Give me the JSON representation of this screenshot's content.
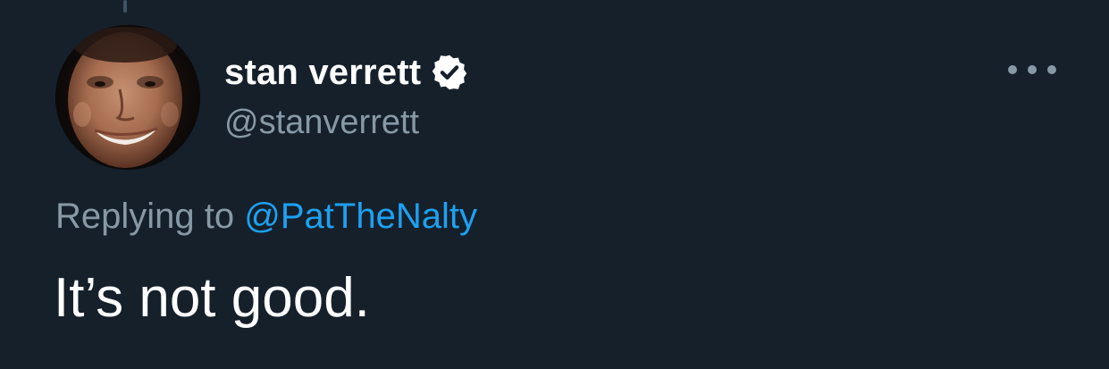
{
  "tweet": {
    "author": {
      "display_name": "stan verrett",
      "handle": "@stanverrett",
      "verified": true,
      "avatar_icon": "user-avatar-photo"
    },
    "reply": {
      "prefix": "Replying to",
      "mention": "@PatTheNalty"
    },
    "text": "It’s not good.",
    "actions": {
      "more_icon": "more-options-icon"
    }
  },
  "colors": {
    "background": "#15202b",
    "primary_text": "#ffffff",
    "secondary_text": "#8899a6",
    "accent": "#1da1f2",
    "thread_line": "#3d5466"
  }
}
